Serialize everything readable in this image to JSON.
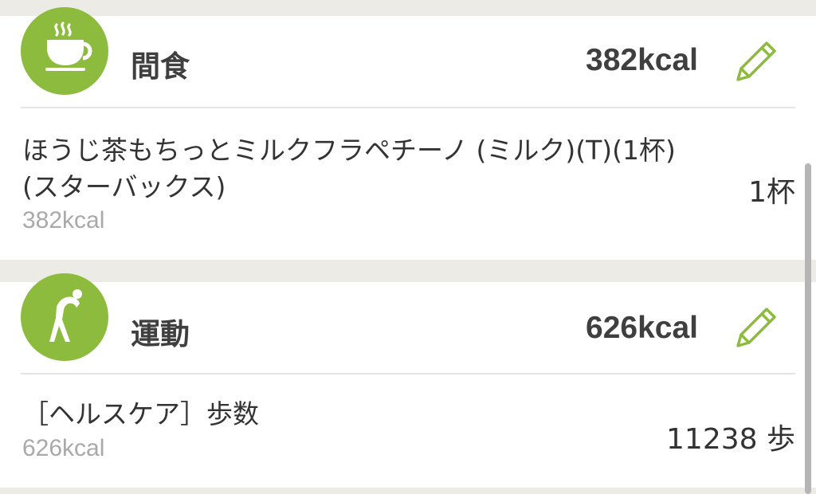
{
  "colors": {
    "accent": "#8cbb3d",
    "background": "#ecebe5"
  },
  "sections": [
    {
      "icon": "coffee-cup-icon",
      "title": "間食",
      "kcal": "382kcal",
      "edit_icon": "pencil-icon",
      "items": [
        {
          "name": "ほうじ茶もちっとミルクフラペチーノ (ミルク)(T)(1杯)(スターバックス)",
          "kcal": "382kcal",
          "quantity": "1杯"
        }
      ]
    },
    {
      "icon": "stretching-person-icon",
      "title": "運動",
      "kcal": "626kcal",
      "edit_icon": "pencil-icon",
      "items": [
        {
          "name": "［ヘルスケア］歩数",
          "kcal": "626kcal",
          "quantity": "11238 歩"
        }
      ]
    }
  ]
}
